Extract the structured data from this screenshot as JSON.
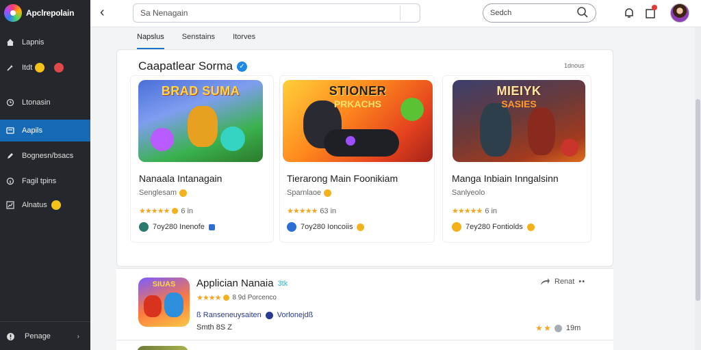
{
  "app": {
    "name": "Apclrepolain"
  },
  "sidebar": {
    "items": [
      {
        "label": "Lapnis",
        "icon": "home-icon"
      },
      {
        "label": "Itdt",
        "icon": "brush-icon"
      },
      {
        "label": "Ltonasin",
        "icon": "clock-icon"
      },
      {
        "label": "Aapils",
        "icon": "apps-icon"
      },
      {
        "label": "Bognesn/bsacs",
        "icon": "pencil-icon"
      },
      {
        "label": "Fagil tpins",
        "icon": "info-icon"
      },
      {
        "label": "Alnatus",
        "icon": "chart-icon"
      }
    ],
    "profile_label": "Penage"
  },
  "topbar": {
    "search_main_value": "Sa Nenagain",
    "search_small_value": "Sedch"
  },
  "tabs": [
    {
      "label": "Napslus",
      "active": true
    },
    {
      "label": "Senstains",
      "active": false
    },
    {
      "label": "Itorves",
      "active": false
    }
  ],
  "featured": {
    "title": "Caapatlear Sorma",
    "see_all": "1dnous",
    "apps": [
      {
        "art_title": "BRAD SUMA",
        "art_colors": [
          "#ffd54a",
          "#ff6d2d"
        ],
        "name": "Nanaala Intanagain",
        "developer": "Senglesam",
        "rating_text": "6 in",
        "meta": "7oy280 Inenofe"
      },
      {
        "art_title": "STIONER",
        "art_sub": "PRKACHS",
        "art_colors": [
          "#2a1f16",
          "#ffe36b"
        ],
        "name": "Tierarong Main Foonikiam",
        "developer": "Sparnlaoe",
        "rating_text": "63 in",
        "meta": "7oy280 Ioncoiis"
      },
      {
        "art_title": "MIEIYK",
        "art_sub": "SASIES",
        "art_colors": [
          "#ffe8a8",
          "#ff9b2f"
        ],
        "name": "Manga Inbiain Inngalsinn",
        "developer": "Sanlyeolo",
        "rating_text": "6 in",
        "meta": "7ey280 Fontiolds"
      }
    ]
  },
  "list_item": {
    "title": "Applician Nanaia",
    "title_badge": "3tk",
    "rating_text": "8 9d Porcenco",
    "meta": "ß Ranseneuysaiten",
    "meta_extra": "Vorlonejdß",
    "meta2": "Smth 8S Z",
    "share_label": "Renat",
    "side_rating": "19m"
  }
}
